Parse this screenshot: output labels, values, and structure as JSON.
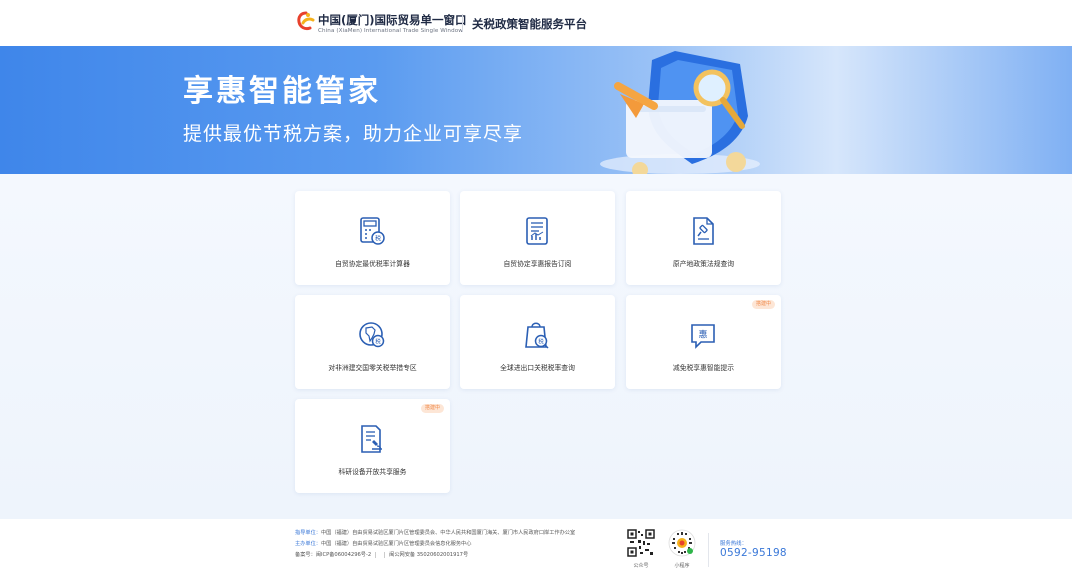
{
  "header": {
    "brand_cn": "中国(厦门)国际贸易单一窗口",
    "brand_en": "China (XiaMen) International Trade Single Window",
    "platform_title": "关税政策智能服务平台"
  },
  "banner": {
    "title": "享惠智能管家",
    "subtitle": "提供最优节税方案，助力企业可享尽享"
  },
  "cards": [
    {
      "label": "自贸协定最优税率计算器",
      "icon": "calculator-tax-icon",
      "tag": ""
    },
    {
      "label": "自贸协定享惠报告订阅",
      "icon": "report-chart-icon",
      "tag": ""
    },
    {
      "label": "原产地政策法规查询",
      "icon": "document-gavel-icon",
      "tag": ""
    },
    {
      "label": "对非洲建交国零关税举措专区",
      "icon": "africa-tax-icon",
      "tag": ""
    },
    {
      "label": "全球进出口关税税率查询",
      "icon": "shopping-bag-tax-icon",
      "tag": ""
    },
    {
      "label": "减免税享惠智能提示",
      "icon": "chat-hui-icon",
      "tag": "搭建中"
    },
    {
      "label": "科研设备开放共享服务",
      "icon": "document-microscope-icon",
      "tag": "搭建中"
    }
  ],
  "footer": {
    "guidance_label": "指导单位：",
    "guidance_value": "中国（福建）自由贸易试验区厦门片区管理委员会、中华人民共和国厦门海关、厦门市人民政府口岸工作办公室",
    "host_label": "主办单位：",
    "host_value": "中国（福建）自由贸易试验区厦门片区管理委员会信息化服务中心",
    "icp": "备案号：闽ICP备06004296号-2",
    "police": "闽公网安备 35020602001917号",
    "qr_official_caption": "公众号",
    "qr_mini_caption": "小程序",
    "hotline_label": "服务热线：",
    "hotline_number": "0592-95198"
  },
  "colors": {
    "primary": "#3f86ea",
    "icon_stroke": "#2b5fb4",
    "tag_bg": "#fde6d6",
    "tag_text": "#f08a4b"
  }
}
